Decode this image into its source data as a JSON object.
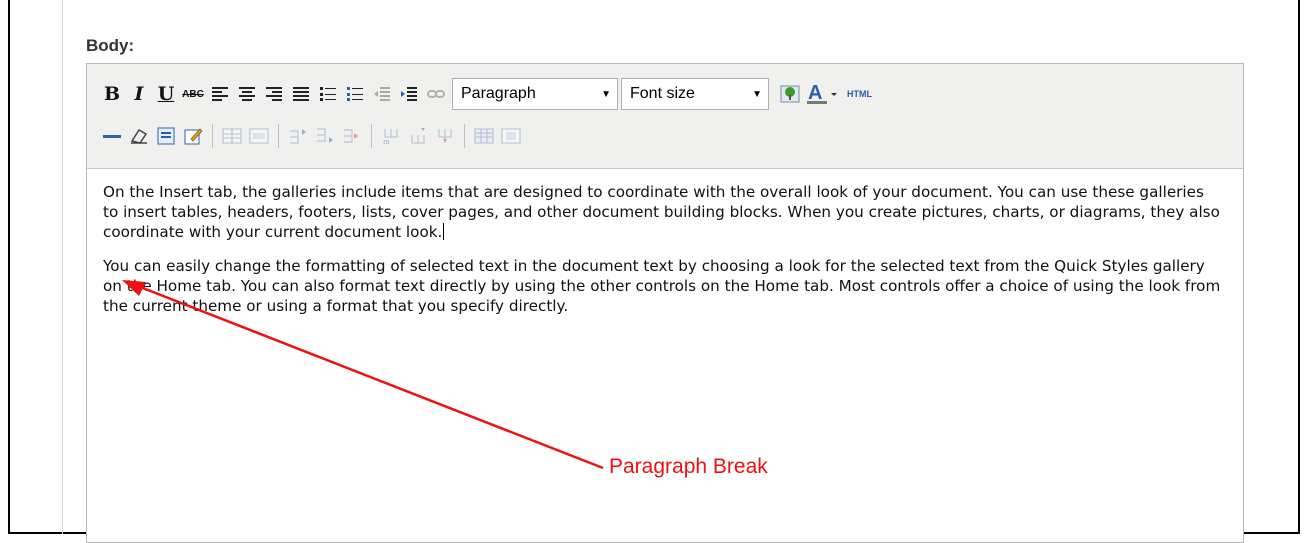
{
  "field": {
    "label": "Body:"
  },
  "toolbar": {
    "bold_label": "B",
    "italic_label": "I",
    "underline_label": "U",
    "strike_label": "ABC",
    "format_select": {
      "value": "Paragraph"
    },
    "fontsize_select": {
      "value": "Font size"
    },
    "font_color_label": "A",
    "html_label": "HTML",
    "icons": {
      "row1": [
        "bold",
        "italic",
        "underline",
        "strikethrough",
        "align-left-icon",
        "align-center-icon",
        "align-right-icon",
        "align-justify-icon",
        "bullet-list-icon",
        "numbered-list-icon",
        "outdent-icon",
        "indent-icon",
        "link-icon",
        "image-icon",
        "font-color-icon",
        "html-source-button"
      ],
      "row2": [
        "horizontal-rule-icon",
        "eraser-icon",
        "select-all-icon",
        "edit-icon",
        "table-icon",
        "table-properties-icon",
        "insert-row-before-icon",
        "insert-row-after-icon",
        "delete-row-icon",
        "insert-col-before-icon",
        "insert-col-after-icon",
        "delete-col-icon",
        "split-cells-icon",
        "merge-cells-icon"
      ]
    }
  },
  "content": {
    "paragraphs": [
      "On the Insert tab, the galleries include items that are designed to coordinate with the overall look of your document. You can use these galleries to insert tables, headers, footers, lists, cover pages, and other document building blocks. When you create pictures, charts, or diagrams, they also coordinate with your current document look.",
      "You can easily change the formatting of selected text in the document text by choosing a look for the selected text from the Quick Styles gallery on the Home tab. You can also format text directly by using the other controls on the Home tab. Most controls offer a choice of using the look from the current theme or using a format that you specify directly."
    ]
  },
  "annotation": {
    "text": "Paragraph Break",
    "color": "#ee1111"
  },
  "colors": {
    "toolbar_bg": "#f0f0ee",
    "border": "#b8b8b8",
    "annotation": "#ee1111",
    "link_blue": "#2b5fb3"
  }
}
